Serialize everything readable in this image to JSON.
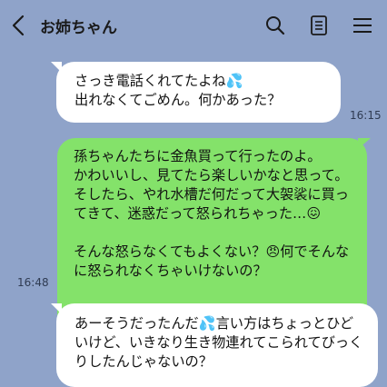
{
  "header": {
    "back_icon": "chevron-left-icon",
    "title": "お姉ちゃん",
    "search_icon": "search-icon",
    "notes_icon": "notes-icon",
    "menu_icon": "hamburger-menu-icon"
  },
  "messages": [
    {
      "direction": "incoming",
      "text": "さっき電話くれてたよね💦\n出れなくてごめん。何かあった？",
      "time": "16:15"
    },
    {
      "direction": "outgoing",
      "text": "孫ちゃんたちに金魚買って行ったのよ。\nかわいいし、見てたら楽しいかなと思って。そしたら、やれ水槽だ何だって大袈裟に買ってきて、迷惑だって怒られちゃった…😖\n\nそんな怒らなくてもよくない？😠何でそんなに怒られなくちゃいけないの？",
      "time": "16:48"
    },
    {
      "direction": "incoming",
      "text": "あーそうだったんだ💦言い方はちょっとひどいけど、いきなり生き物連れてこられてびっくりしたんじゃないの？",
      "time": ""
    }
  ],
  "colors": {
    "background": "#8fa3c9",
    "incoming_bubble": "#ffffff",
    "outgoing_bubble": "#84e26a"
  }
}
